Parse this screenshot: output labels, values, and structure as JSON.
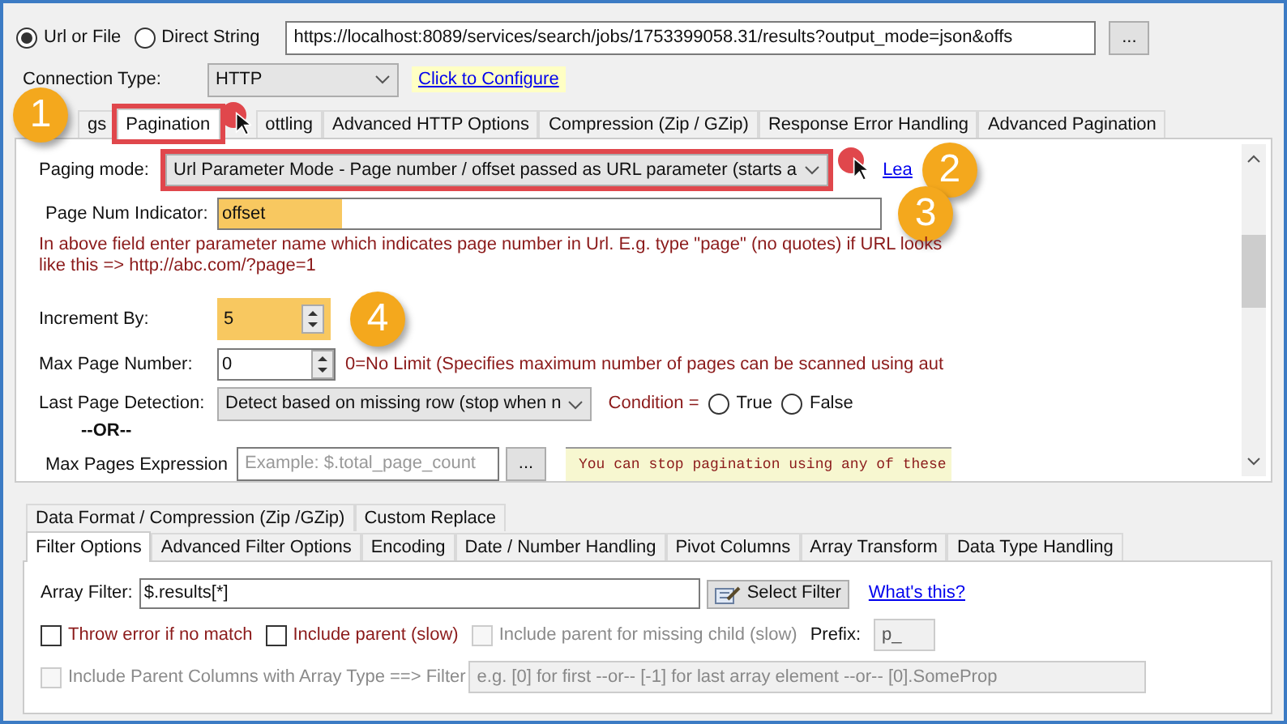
{
  "source": {
    "options": [
      {
        "label": "Url or File",
        "selected": true
      },
      {
        "label": "Direct String",
        "selected": false
      }
    ],
    "url": "https://localhost:8089/services/search/jobs/1753399058.31/results?output_mode=json&offs",
    "browse": "..."
  },
  "connection": {
    "label": "Connection Type:",
    "value": "HTTP",
    "link": "Click to Configure"
  },
  "tabs": [
    {
      "label": "gs",
      "selected": false,
      "outlined": false
    },
    {
      "label": "Pagination",
      "selected": true,
      "outlined": true
    },
    {
      "label": "ottling",
      "selected": false,
      "outlined": false
    },
    {
      "label": "Advanced HTTP Options",
      "selected": false,
      "outlined": false
    },
    {
      "label": "Compression (Zip / GZip)",
      "selected": false,
      "outlined": false
    },
    {
      "label": "Response Error Handling",
      "selected": false,
      "outlined": false
    },
    {
      "label": "Advanced Pagination",
      "selected": false,
      "outlined": false
    }
  ],
  "pagination": {
    "paging_mode": {
      "label": "Paging mode:",
      "value": "Url Parameter Mode - Page number / offset passed as URL parameter (starts a",
      "outlined": true,
      "link": "Lea"
    },
    "page_num": {
      "label": "Page Num Indicator:",
      "value": "offset",
      "highlighted": true,
      "hint": "In above field enter parameter name which indicates page number in Url. E.g. type \"page\" (no quotes) if URL looks like this => http://abc.com/?page=1"
    },
    "increment": {
      "label": "Increment By:",
      "value": "5",
      "highlighted": true
    },
    "max_page": {
      "label": "Max Page Number:",
      "value": "0",
      "highlighted": false,
      "note": "0=No Limit (Specifies maximum number of pages can be scanned using aut"
    },
    "last_page": {
      "label": "Last Page Detection:",
      "value": "Detect based on missing row (stop when n",
      "condition_label": "Condition =",
      "conditions": [
        {
          "label": "True",
          "selected": false
        },
        {
          "label": "False",
          "selected": false
        }
      ]
    },
    "or": "--OR--",
    "max_pages_expr": {
      "label": "Max Pages Expression",
      "placeholder": "Example:  $.total_page_count",
      "button": "...",
      "note": "You can stop pagination using any of these"
    }
  },
  "annotations": [
    "1",
    "2",
    "3",
    "4"
  ],
  "lower_tabs": [
    [
      {
        "label": "Data Format / Compression (Zip /GZip)",
        "selected": false
      },
      {
        "label": "Custom Replace",
        "selected": false
      }
    ],
    [
      {
        "label": "Filter Options",
        "selected": true
      },
      {
        "label": "Advanced Filter Options",
        "selected": false
      },
      {
        "label": "Encoding",
        "selected": false
      },
      {
        "label": "Date / Number Handling",
        "selected": false
      },
      {
        "label": "Pivot Columns",
        "selected": false
      },
      {
        "label": "Array Transform",
        "selected": false
      },
      {
        "label": "Data Type Handling",
        "selected": false
      }
    ]
  ],
  "filter": {
    "label": "Array Filter:",
    "value": "$.results[*]",
    "button": "Select Filter",
    "link": "What's this?",
    "options": [
      {
        "label": "Throw error if no match",
        "checked": false,
        "disabled": false
      },
      {
        "label": "Include parent (slow)",
        "checked": false,
        "disabled": false
      },
      {
        "label": "Include parent for missing child (slow)",
        "checked": false,
        "disabled": true
      }
    ],
    "prefix": {
      "label": "Prefix:",
      "value": "p_"
    },
    "parent_columns": {
      "label": "Include Parent Columns with Array Type ==> Filter",
      "checked": false,
      "disabled": true,
      "placeholder": "e.g. [0] for first --or-- [-1] for last array element --or-- [0].SomeProp"
    }
  }
}
